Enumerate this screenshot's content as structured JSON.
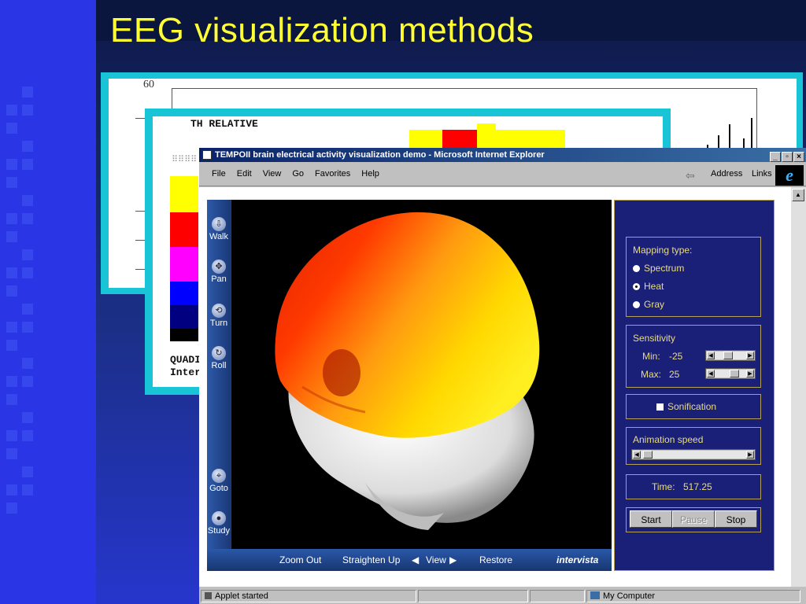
{
  "slide": {
    "title": "EEG visualization methods"
  },
  "back_panel": {
    "axis_top_value": "60",
    "tick_labels": [
      "-",
      "-",
      "-",
      "-"
    ]
  },
  "mid_panel": {
    "label": "TH RELATIVE",
    "dotted": "⠿⠿⠿⠿",
    "bottom_line1": "QUADI",
    "bottom_line2": "Inter"
  },
  "browser": {
    "title": "TEMPOII brain electrical activity visualization demo - Microsoft Internet Explorer",
    "window_buttons": [
      "_",
      "▫",
      "×"
    ],
    "menu": [
      "File",
      "Edit",
      "View",
      "Go",
      "Favorites",
      "Help"
    ],
    "menu_underline": [
      "F",
      "E",
      "V",
      "G",
      "a",
      "H"
    ],
    "address_label": "Address",
    "links_label": "Links",
    "status_left": "Applet started",
    "status_right": "My Computer"
  },
  "viewer": {
    "nav_items": [
      {
        "label": "Walk",
        "icon": "walk-icon",
        "glyph": "⇩"
      },
      {
        "label": "Pan",
        "icon": "pan-icon",
        "glyph": "✥"
      },
      {
        "label": "Turn",
        "icon": "turn-icon",
        "glyph": "⟲"
      },
      {
        "label": "Roll",
        "icon": "roll-icon",
        "glyph": "↻"
      },
      {
        "label": "Goto",
        "icon": "goto-icon",
        "glyph": "⌖"
      },
      {
        "label": "Study",
        "icon": "study-icon",
        "glyph": "●"
      }
    ],
    "bottom": {
      "zoom_out": "Zoom Out",
      "straighten_up": "Straighten Up",
      "view": "View",
      "restore": "Restore",
      "brand": "intervista"
    }
  },
  "controls": {
    "mapping_title": "Mapping type:",
    "mapping_options": [
      "Spectrum",
      "Heat",
      "Gray"
    ],
    "mapping_selected": "Heat",
    "sensitivity_title": "Sensitivity",
    "min_label": "Min:",
    "min_value": "-25",
    "max_label": "Max:",
    "max_value": "25",
    "sonification_label": "Sonification",
    "animation_title": "Animation speed",
    "time_label": "Time:",
    "time_value": "517.25",
    "buttons": {
      "start": "Start",
      "pause": "Pause",
      "stop": "Stop"
    }
  },
  "colors": {
    "slide_title": "#ffff33",
    "panel_accent": "#19c4d6",
    "control_text": "#e8dc86",
    "control_bg": "#1a1f78"
  }
}
